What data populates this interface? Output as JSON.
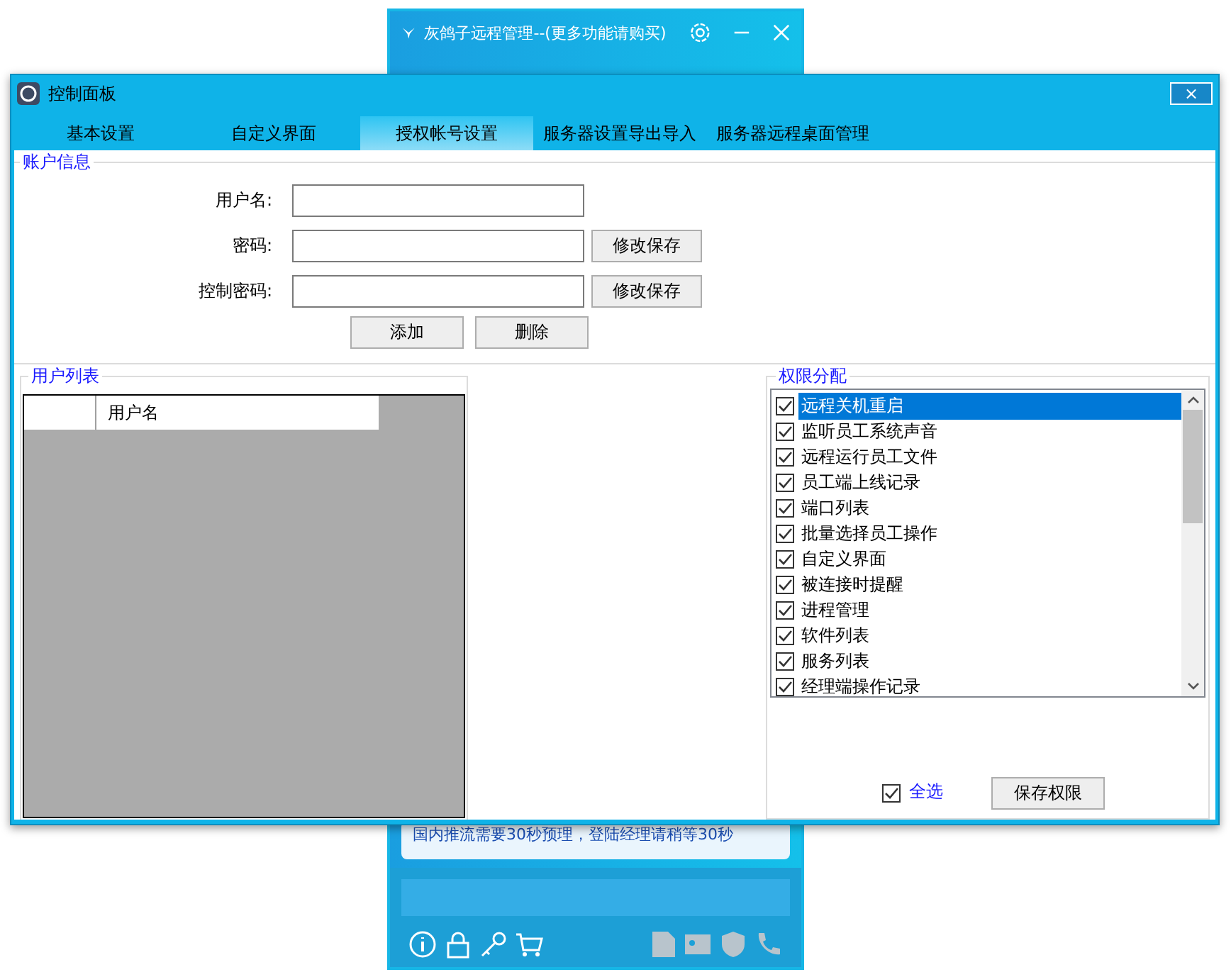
{
  "background_window": {
    "title": "灰鸽子远程管理--(更多功能请购买)",
    "notice": "国内推流需要30秒预理，登陆经理请稍等30秒"
  },
  "window": {
    "title": "控制面板",
    "close": "×"
  },
  "tabs": [
    {
      "label": "基本设置",
      "selected": false
    },
    {
      "label": "自定义界面",
      "selected": false
    },
    {
      "label": "授权帐号设置",
      "selected": true
    },
    {
      "label": "服务器设置导出导入",
      "selected": false
    },
    {
      "label": "服务器远程桌面管理",
      "selected": false
    }
  ],
  "account": {
    "legend": "账户信息",
    "fields": [
      {
        "label": "用户名:"
      },
      {
        "label": "密码:",
        "button": "修改保存"
      },
      {
        "label": "控制密码:",
        "button": "修改保存"
      }
    ],
    "buttons": [
      "添加",
      "删除"
    ]
  },
  "user_list": {
    "legend": "用户列表",
    "columns": [
      "用户名"
    ]
  },
  "permissions": {
    "legend": "权限分配",
    "items": [
      {
        "label": "远程关机重启",
        "checked": true,
        "selected": true
      },
      {
        "label": "监听员工系统声音",
        "checked": true,
        "selected": false
      },
      {
        "label": "远程运行员工文件",
        "checked": true,
        "selected": false
      },
      {
        "label": "员工端上线记录",
        "checked": true,
        "selected": false
      },
      {
        "label": "端口列表",
        "checked": true,
        "selected": false
      },
      {
        "label": "批量选择员工操作",
        "checked": true,
        "selected": false
      },
      {
        "label": "自定义界面",
        "checked": true,
        "selected": false
      },
      {
        "label": "被连接时提醒",
        "checked": true,
        "selected": false
      },
      {
        "label": "进程管理",
        "checked": true,
        "selected": false
      },
      {
        "label": "软件列表",
        "checked": true,
        "selected": false
      },
      {
        "label": "服务列表",
        "checked": true,
        "selected": false
      },
      {
        "label": "经理端操作记录",
        "checked": true,
        "selected": false
      }
    ],
    "select_all": {
      "label": "全选",
      "checked": true
    },
    "save": "保存权限"
  }
}
